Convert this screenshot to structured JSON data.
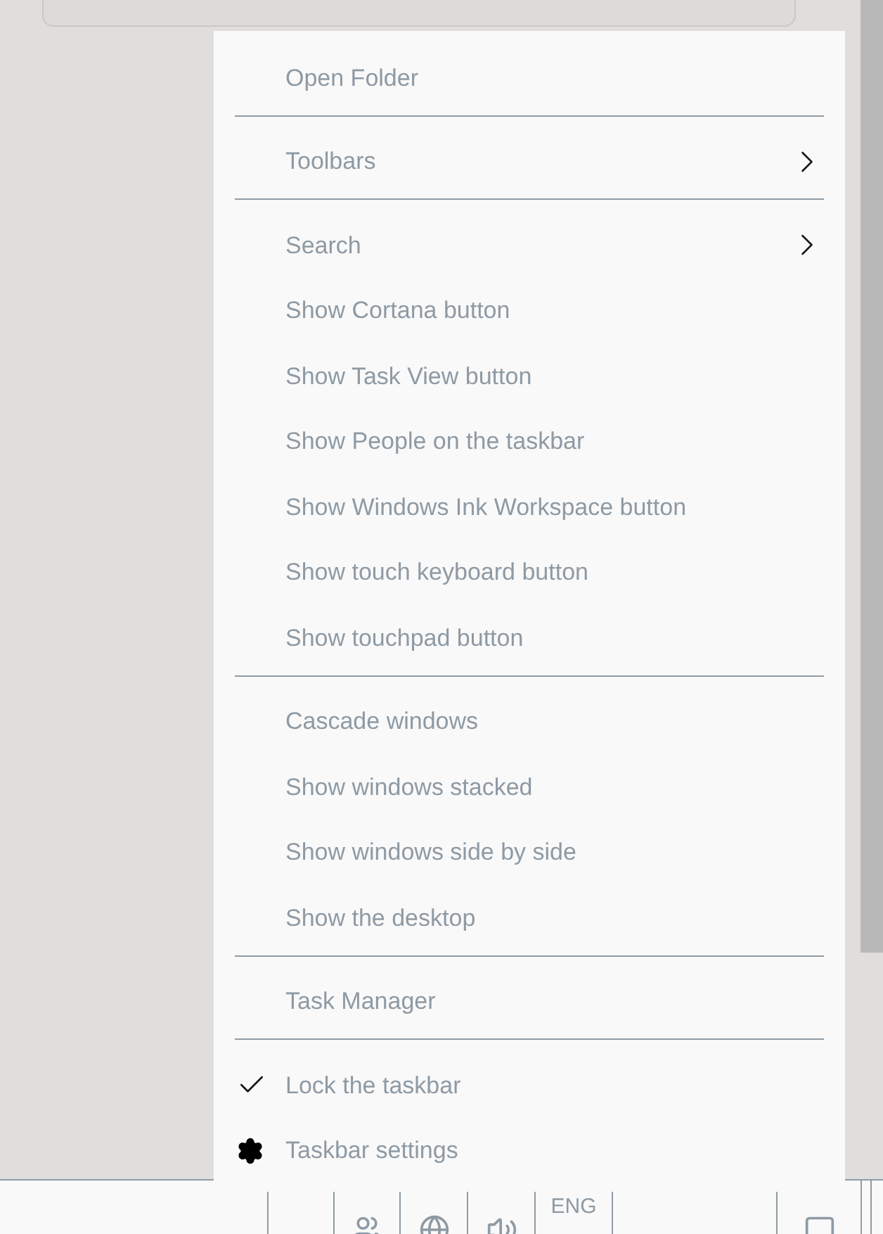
{
  "menu": {
    "items": [
      {
        "kind": "item",
        "label": "Open Folder"
      },
      {
        "kind": "separator"
      },
      {
        "kind": "submenu",
        "label": "Toolbars"
      },
      {
        "kind": "separator"
      },
      {
        "kind": "submenu",
        "label": "Search"
      },
      {
        "kind": "item",
        "label": "Show Cortana button"
      },
      {
        "kind": "item",
        "label": "Show Task View button"
      },
      {
        "kind": "item",
        "label": "Show People on the taskbar"
      },
      {
        "kind": "item",
        "label": "Show Windows Ink Workspace button"
      },
      {
        "kind": "item",
        "label": "Show touch keyboard button"
      },
      {
        "kind": "item",
        "label": "Show touchpad button"
      },
      {
        "kind": "separator"
      },
      {
        "kind": "item",
        "label": "Cascade windows"
      },
      {
        "kind": "item",
        "label": "Show windows stacked"
      },
      {
        "kind": "item",
        "label": "Show windows side by side"
      },
      {
        "kind": "item",
        "label": "Show the desktop"
      },
      {
        "kind": "separator"
      },
      {
        "kind": "item",
        "label": "Task Manager"
      },
      {
        "kind": "separator"
      },
      {
        "kind": "checkable",
        "label": "Lock the taskbar",
        "checked": true
      },
      {
        "kind": "settings",
        "label": "Taskbar settings"
      }
    ]
  },
  "taskbar": {
    "language": "ENG"
  }
}
